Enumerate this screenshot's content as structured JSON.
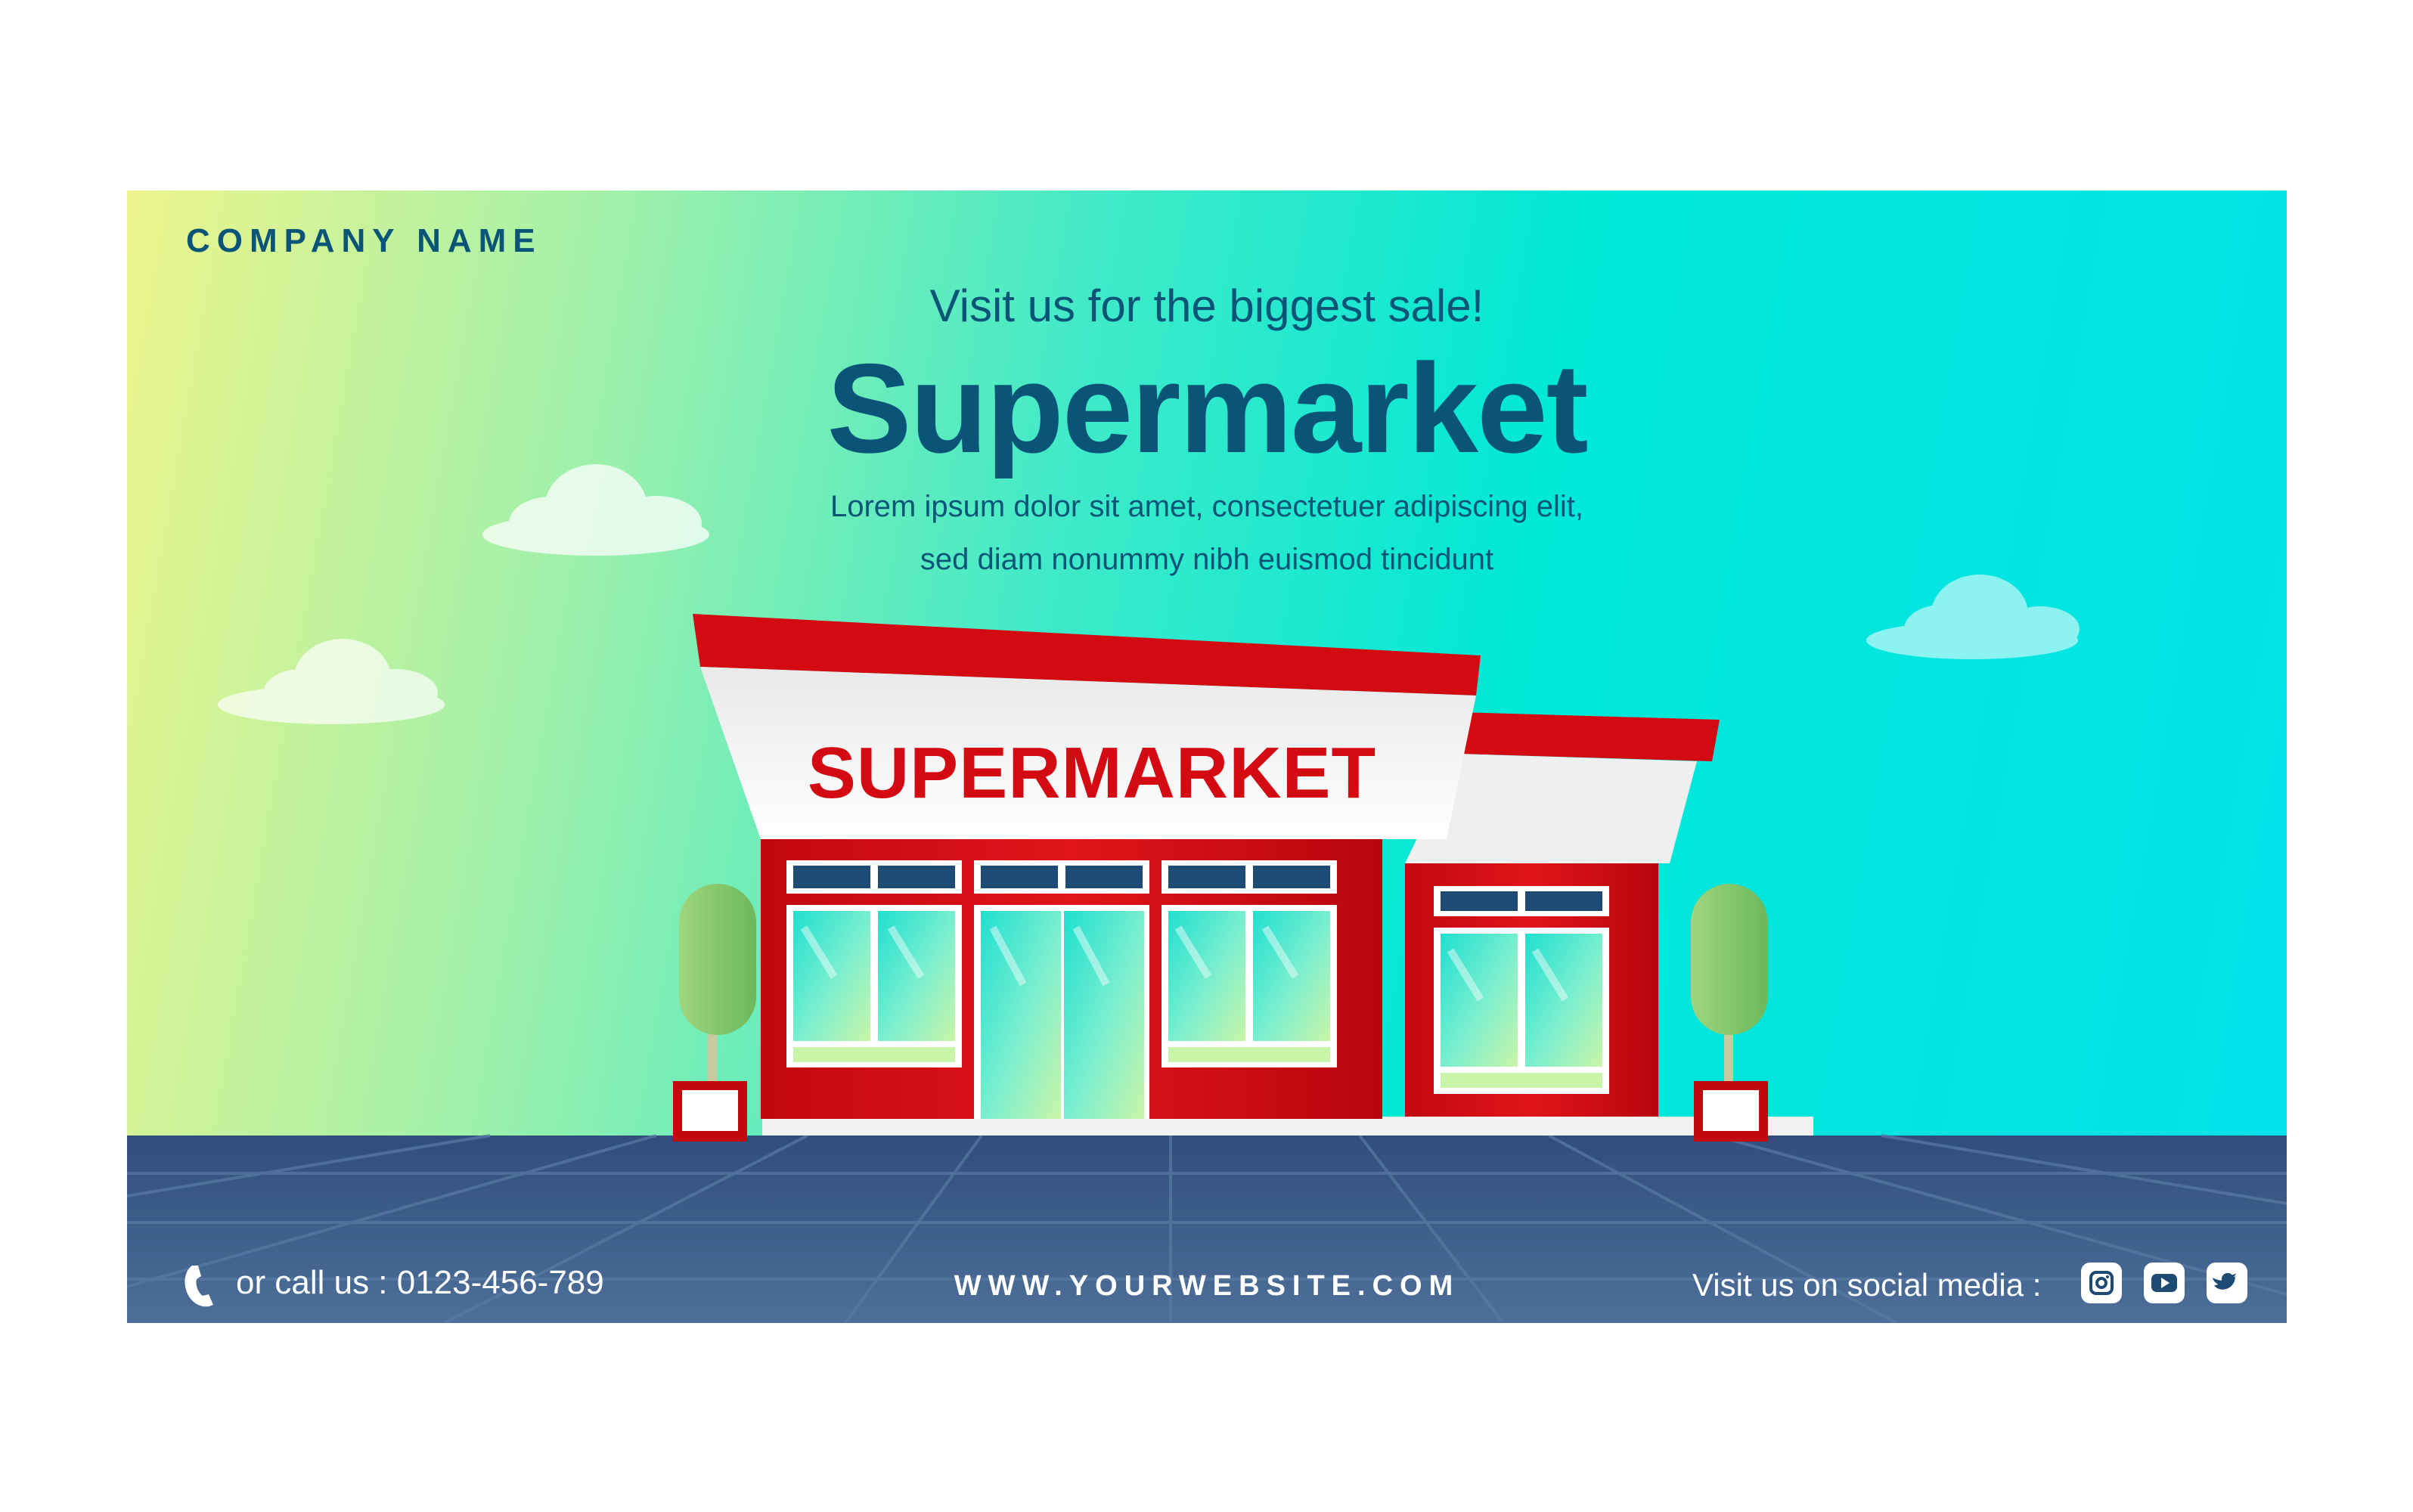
{
  "banner": {
    "company_name": "COMPANY NAME",
    "tagline": "Visit us for the biggest sale!",
    "headline": "Supermarket",
    "description_line1": "Lorem ipsum dolor sit amet, consectetuer adipiscing elit,",
    "description_line2": "sed diam nonummy nibh euismod tincidunt"
  },
  "store": {
    "sign_text": "SUPERMARKET"
  },
  "footer": {
    "phone_text": "or call us : 0123-456-789",
    "website": "WWW.YOURWEBSITE.COM",
    "social_label": "Visit us on social media :",
    "social_icons": [
      "instagram-icon",
      "youtube-icon",
      "twitter-icon"
    ]
  },
  "colors": {
    "text_primary": "#0a5478",
    "store_red": "#d40a12",
    "ground": "#3e5f8c",
    "gradient_left": "#eef58c",
    "gradient_right": "#00e2ea"
  }
}
